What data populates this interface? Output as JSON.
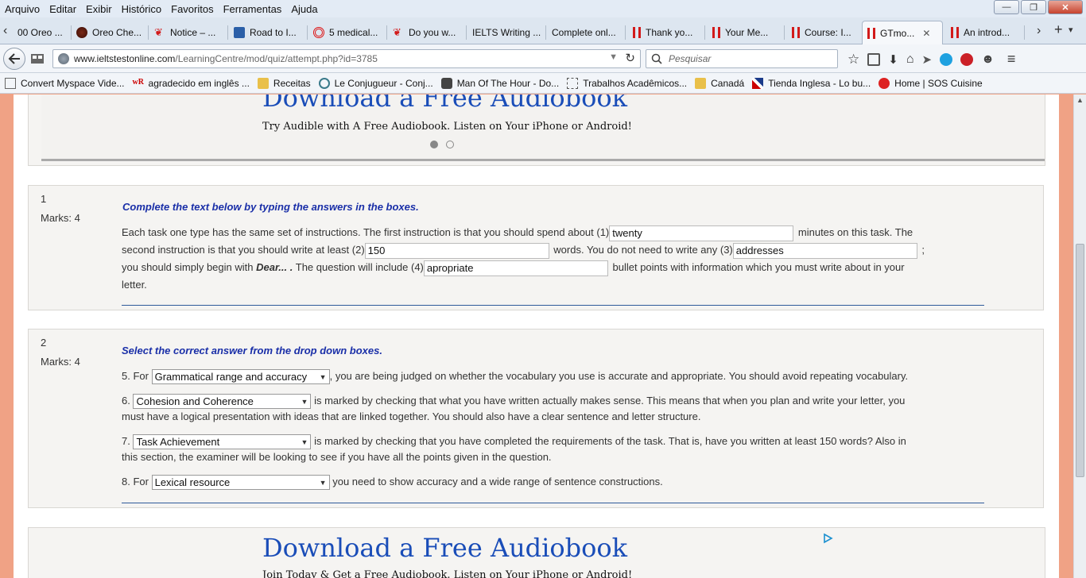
{
  "menu": [
    "Arquivo",
    "Editar",
    "Exibir",
    "Histórico",
    "Favoritos",
    "Ferramentas",
    "Ajuda"
  ],
  "window_buttons": {
    "minimize": "—",
    "maximize": "❐",
    "close": "✕"
  },
  "tabs": [
    {
      "label": "00 Oreo ...",
      "icon": "blank-icon"
    },
    {
      "label": "Oreo Che...",
      "icon": "site-icon"
    },
    {
      "label": "Notice – ...",
      "icon": "maple-leaf-icon"
    },
    {
      "label": "Road to I...",
      "icon": "bookmark-icon"
    },
    {
      "label": "5 medical...",
      "icon": "target-icon"
    },
    {
      "label": "Do you w...",
      "icon": "maple-leaf-icon"
    },
    {
      "label": "IELTS Writing ...",
      "icon": "blank-icon"
    },
    {
      "label": "Complete onl...",
      "icon": "blank-icon"
    },
    {
      "label": "Thank yo...",
      "icon": "gtm-icon"
    },
    {
      "label": "Your Me...",
      "icon": "gtm-icon"
    },
    {
      "label": "Course: I...",
      "icon": "gtm-icon"
    },
    {
      "label": "GTmo...",
      "icon": "gtm-icon",
      "active": true
    },
    {
      "label": "An introd...",
      "icon": "gtm-icon"
    }
  ],
  "tab_close": "✕",
  "tab_controls": {
    "back": "‹",
    "forward": "›",
    "new_tab": "+",
    "list": "▾"
  },
  "url": {
    "domain": "www.ieltstestonline.com",
    "path": "/LearningCentre/mod/quiz/attempt.php?id=3785"
  },
  "search": {
    "placeholder": "Pesquisar"
  },
  "bookmarks": [
    {
      "label": "Convert Myspace Vide...",
      "icon": "blank-icon"
    },
    {
      "label": "agradecido em inglês ...",
      "icon": "wr-icon"
    },
    {
      "label": "Receitas",
      "icon": "folder-icon"
    },
    {
      "label": "Le Conjugueur - Conj...",
      "icon": "site-icon"
    },
    {
      "label": "Man Of The Hour - Do...",
      "icon": "apple-icon"
    },
    {
      "label": "Trabalhos Acadêmicos...",
      "icon": "blank-icon"
    },
    {
      "label": "Canadá",
      "icon": "folder-icon"
    },
    {
      "label": "Tienda Inglesa - Lo bu...",
      "icon": "flag-icon"
    },
    {
      "label": "Home | SOS Cuisine",
      "icon": "tomato-icon"
    }
  ],
  "ad_top": {
    "title": "Download a Free Audiobook",
    "subtitle": "Try Audible with A Free Audiobook. Listen on Your iPhone or Android!"
  },
  "ad_bottom": {
    "title": "Download a Free Audiobook",
    "subtitle": "Join Today & Get a Free Audiobook. Listen on Your iPhone or Android!"
  },
  "q1": {
    "number": "1",
    "marks": "Marks: 4",
    "instruction": "Complete the text below by typing the answers in the boxes.",
    "t1": "Each task one type has the same set of instructions. The first instruction is that you should spend about (1)",
    "a1": "twenty",
    "t2": "minutes on this task. The",
    "t3": "second instruction is that you should write at least (2)",
    "a2": "150",
    "t4": "words. You do not need to write any (3)",
    "a3": "addresses",
    "t5": ";",
    "t6": "you should simply begin with",
    "t6b": "Dear... .",
    "t7": "The question will include (4)",
    "a4": "apropriate",
    "t8": "bullet points with information which you must write about in your",
    "t9": "letter."
  },
  "q2": {
    "number": "2",
    "marks": "Marks: 4",
    "instruction": "Select the correct answer from the drop down boxes.",
    "s5_pre": "5. For",
    "s5_sel": "Grammatical range and accuracy",
    "s5_post": ", you are being judged on whether the vocabulary you use is accurate and appropriate. You should avoid repeating vocabulary.",
    "s6_pre": "6.",
    "s6_sel": "Cohesion and Coherence",
    "s6_post": "is marked by checking that what you have written actually makes sense. This means that when you plan and write your letter, you",
    "s6_line2": "must have a logical presentation with ideas that are linked together. You should also have a clear sentence and letter structure.",
    "s7_pre": "7.",
    "s7_sel": "Task Achievement",
    "s7_post": "is marked by checking that you have completed the requirements of the task. That is, have you written at least 150 words? Also in",
    "s7_line2": "this section, the examiner will be looking to see if you have all the points given in the question.",
    "s8_pre": "8. For",
    "s8_sel": "Lexical resource",
    "s8_post": "you need to show accuracy and a wide range of sentence constructions."
  },
  "colors": {
    "link_blue": "#1a4db8",
    "instruction_blue": "#1a2fa8",
    "rule": "#2e5a9a",
    "page_bg": "#f0a285"
  }
}
